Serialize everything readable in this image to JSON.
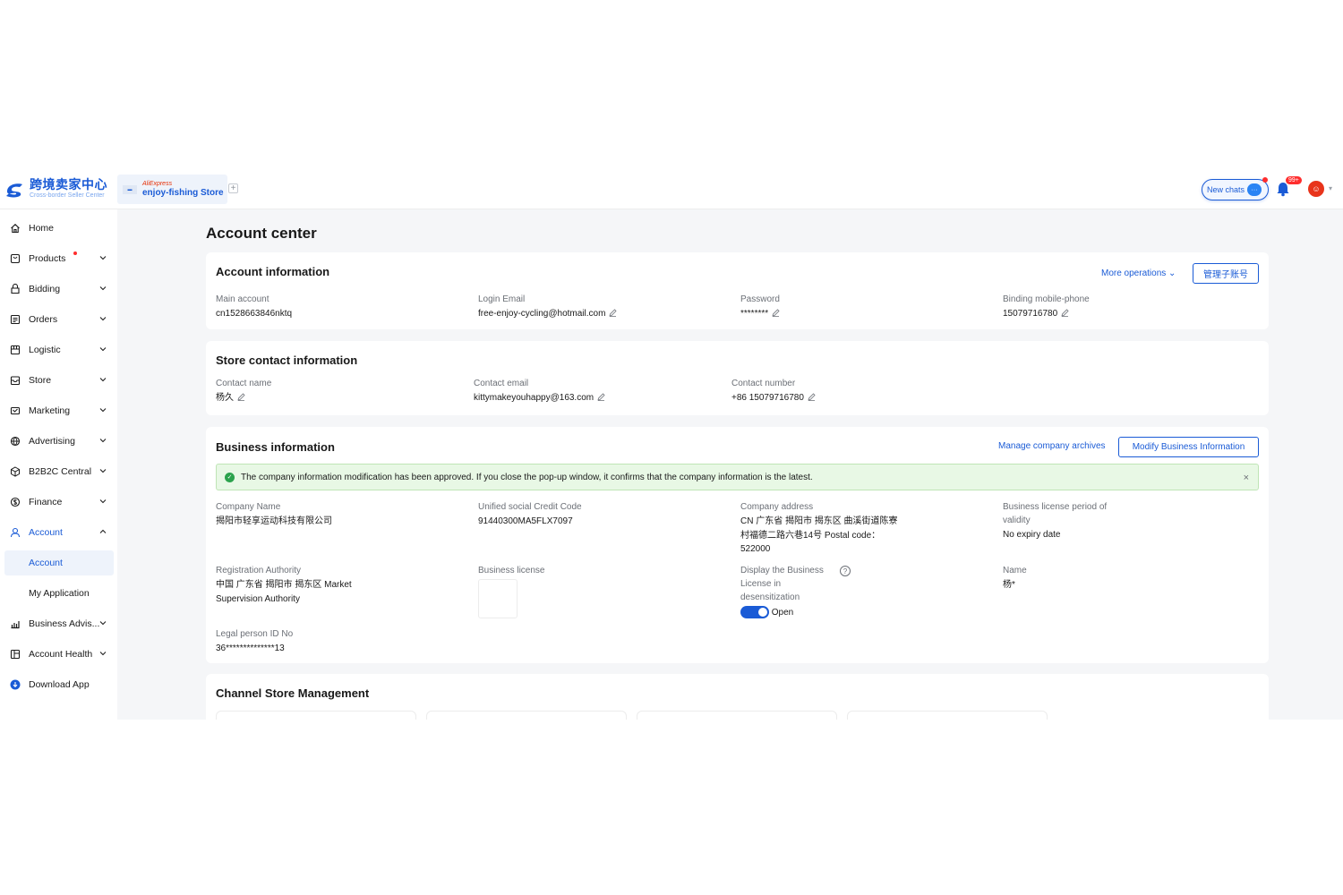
{
  "header": {
    "logo_cn": "跨境卖家中心",
    "logo_en": "Cross-border Seller Center",
    "store_brand": "AliExpress",
    "store_name": "enjoy-fishing Store",
    "add_store": "+",
    "new_chats": "New chats",
    "notifications_badge": "99+"
  },
  "sidebar": {
    "items": [
      {
        "label": "Home",
        "icon": "home-icon"
      },
      {
        "label": "Products",
        "icon": "products-icon"
      },
      {
        "label": "Bidding",
        "icon": "bidding-icon"
      },
      {
        "label": "Orders",
        "icon": "orders-icon"
      },
      {
        "label": "Logistic",
        "icon": "logistic-icon"
      },
      {
        "label": "Store",
        "icon": "store-icon"
      },
      {
        "label": "Marketing",
        "icon": "marketing-icon"
      },
      {
        "label": "Advertising",
        "icon": "advertising-icon"
      },
      {
        "label": "B2B2C Central",
        "icon": "b2b2c-icon"
      },
      {
        "label": "Finance",
        "icon": "finance-icon"
      },
      {
        "label": "Account",
        "icon": "account-icon"
      },
      {
        "label": "Account",
        "icon": ""
      },
      {
        "label": "My Application",
        "icon": ""
      },
      {
        "label": "Business Advis...",
        "icon": "business-advisor-icon"
      },
      {
        "label": "Account Health",
        "icon": "account-health-icon"
      },
      {
        "label": "Download App",
        "icon": "download-icon"
      }
    ]
  },
  "page": {
    "title": "Account center"
  },
  "account_info": {
    "title": "Account information",
    "more_operations": "More operations",
    "manage_sub_accounts": "管理子账号",
    "main_account_label": "Main account",
    "main_account_value": "cn1528663846nktq",
    "login_email_label": "Login Email",
    "login_email_value": "free-enjoy-cycling@hotmail.com",
    "password_label": "Password",
    "password_value": "********",
    "phone_label": "Binding mobile-phone",
    "phone_value": "15079716780"
  },
  "store_contact": {
    "title": "Store contact information",
    "name_label": "Contact name",
    "name_value": "杨久",
    "email_label": "Contact email",
    "email_value": "kittymakeyouhappy@163.com",
    "number_label": "Contact number",
    "number_value": "+86 15079716780"
  },
  "business_info": {
    "title": "Business information",
    "manage_archives": "Manage company archives",
    "modify_button": "Modify Business Information",
    "alert_text": "The company information modification has been approved. If you close the pop-up window, it confirms that the company information is the latest.",
    "alert_close": "×",
    "company_name_label": "Company Name",
    "company_name_value": "揭阳市轻享运动科技有限公司",
    "credit_code_label": "Unified social Credit Code",
    "credit_code_value": "91440300MA5FLX7097",
    "address_label": "Company address",
    "address_line1": "CN 广东省 揭阳市 揭东区 曲溪街道陈寮",
    "address_line2": "村福德二路六巷14号 Postal code：",
    "address_line3": "522000",
    "license_period_label_1": "Business license period of",
    "license_period_label_2": "validity",
    "license_period_value": "No expiry date",
    "reg_authority_label": "Registration Authority",
    "reg_authority_line1": "中国 广东省 揭阳市 揭东区 Market",
    "reg_authority_line2": "Supervision Authority",
    "license_label": "Business license",
    "display_label_1": "Display the Business",
    "display_label_2": "License in",
    "display_label_3": "desensitization",
    "toggle_state": "Open",
    "name_label": "Name",
    "name_value": "杨*",
    "legal_id_label": "Legal person ID No",
    "legal_id_value": "36**************13"
  },
  "channel_store": {
    "title": "Channel Store Management"
  },
  "colors": {
    "accent": "#1a5bd6",
    "alert_bg": "#e8f8e5",
    "badge": "#ff2d2d"
  }
}
